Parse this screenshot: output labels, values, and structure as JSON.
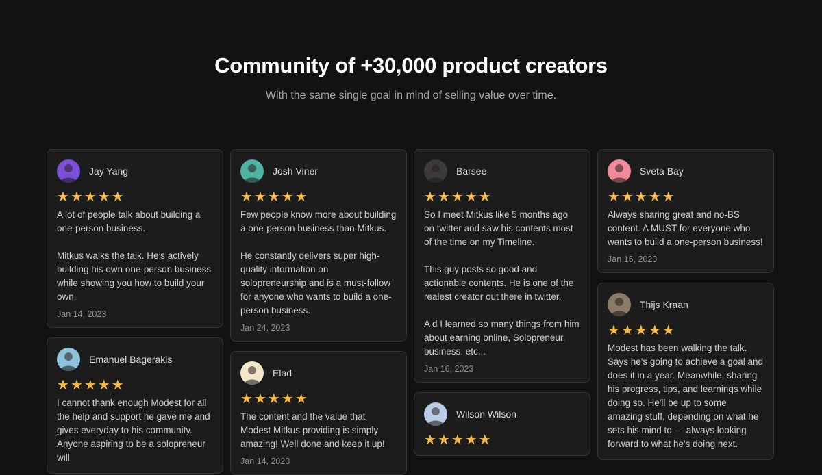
{
  "header": {
    "title": "Community of +30,000 product creators",
    "subtitle": "With the same single goal in mind of selling value over time."
  },
  "colors": {
    "background": "#121212",
    "card": "#1c1c1c",
    "star": "#f5b947"
  },
  "columns": [
    {
      "cards": [
        {
          "name": "Jay Yang",
          "avatar_color": "#7c4fd8",
          "rating": 5,
          "paragraphs": [
            "A lot of people talk about building a one-person business.",
            "Mitkus walks the talk. He’s actively building his own one-person business while showing you how to build your own."
          ],
          "date": "Jan 14, 2023"
        },
        {
          "name": "Emanuel Bagerakis",
          "avatar_color": "#8fc3dc",
          "rating": 5,
          "paragraphs": [
            "I cannot thank enough Modest for all the help and support he gave me and gives everyday to his community. Anyone aspiring to be a solopreneur will"
          ],
          "date": ""
        }
      ]
    },
    {
      "cards": [
        {
          "name": "Josh Viner",
          "avatar_color": "#4fb3a3",
          "rating": 5,
          "paragraphs": [
            "Few people know more about building a one-person business than Mitkus.",
            "He constantly delivers super high-quality information on solopreneurship and is a must-follow for anyone who wants to build a one-person business."
          ],
          "date": "Jan 24, 2023"
        },
        {
          "name": "Elad",
          "avatar_color": "#f2e6c9",
          "rating": 5,
          "paragraphs": [
            "The content and the value that Modest Mitkus providing is simply amazing! Well done and keep it up!"
          ],
          "date": "Jan 14, 2023"
        }
      ]
    },
    {
      "cards": [
        {
          "name": "Barsee",
          "avatar_color": "#3a3a3a",
          "rating": 5,
          "paragraphs": [
            "So I meet Mitkus like 5 months ago on twitter and saw his contents most of the time on my Timeline.",
            "This guy posts so good and actionable contents. He is one of the realest creator out there in twitter.",
            "A d I learned so many things from him about earning online, Solopreneur, business, etc..."
          ],
          "date": "Jan 16, 2023"
        },
        {
          "name": "Wilson Wilson",
          "avatar_color": "#b9cde6",
          "rating": 5,
          "paragraphs": [],
          "date": ""
        }
      ]
    },
    {
      "cards": [
        {
          "name": "Sveta Bay",
          "avatar_color": "#f08a9a",
          "rating": 5,
          "paragraphs": [
            "Always sharing great and no-BS content. A MUST for everyone who wants to build a one-person business!"
          ],
          "date": "Jan 16, 2023"
        },
        {
          "name": "Thijs Kraan",
          "avatar_color": "#8a7a68",
          "rating": 5,
          "paragraphs": [
            "Modest has been walking the talk. Says he's going to achieve a goal and does it in a year. Meanwhile, sharing his progress, tips, and learnings while doing so. He'll be up to some amazing stuff, depending on what he sets his mind to — always looking forward to what he's doing next."
          ],
          "date": ""
        }
      ]
    }
  ]
}
